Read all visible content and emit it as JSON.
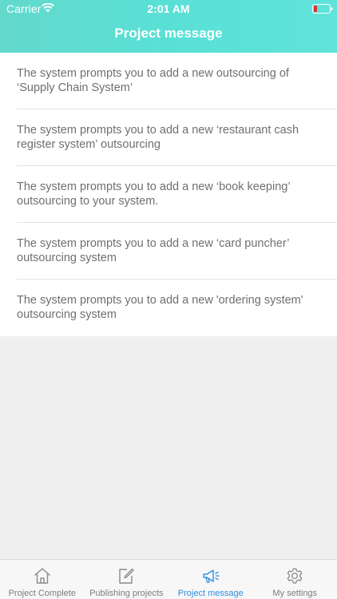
{
  "status_bar": {
    "carrier": "Carrier",
    "time": "2:01 AM",
    "wifi_icon": "wifi-icon",
    "battery_icon": "battery-low-icon",
    "battery_color": "#e0302c"
  },
  "header": {
    "title": "Project message",
    "background_color": "#5adfd3"
  },
  "messages": [
    {
      "text": "The system prompts you to add a new outsourcing of ‘Supply Chain System’"
    },
    {
      "text": "The system prompts you to add a new ‘restaurant cash register system’ outsourcing"
    },
    {
      "text": "The system prompts you to add a new ‘book keeping’ outsourcing to your system."
    },
    {
      "text": "The system prompts you to add a new ‘card puncher’ outsourcing system"
    },
    {
      "text": "The system prompts you to add a new 'ordering system' outsourcing system"
    }
  ],
  "tab_bar": {
    "active_color": "#2e8ee0",
    "inactive_color": "#7d7d7d",
    "tabs": [
      {
        "label": "Project Complete",
        "icon": "home-icon",
        "active": false
      },
      {
        "label": "Publishing projects",
        "icon": "edit-icon",
        "active": false
      },
      {
        "label": "Project message",
        "icon": "megaphone-icon",
        "active": true
      },
      {
        "label": "My settings",
        "icon": "gear-icon",
        "active": false
      }
    ]
  }
}
